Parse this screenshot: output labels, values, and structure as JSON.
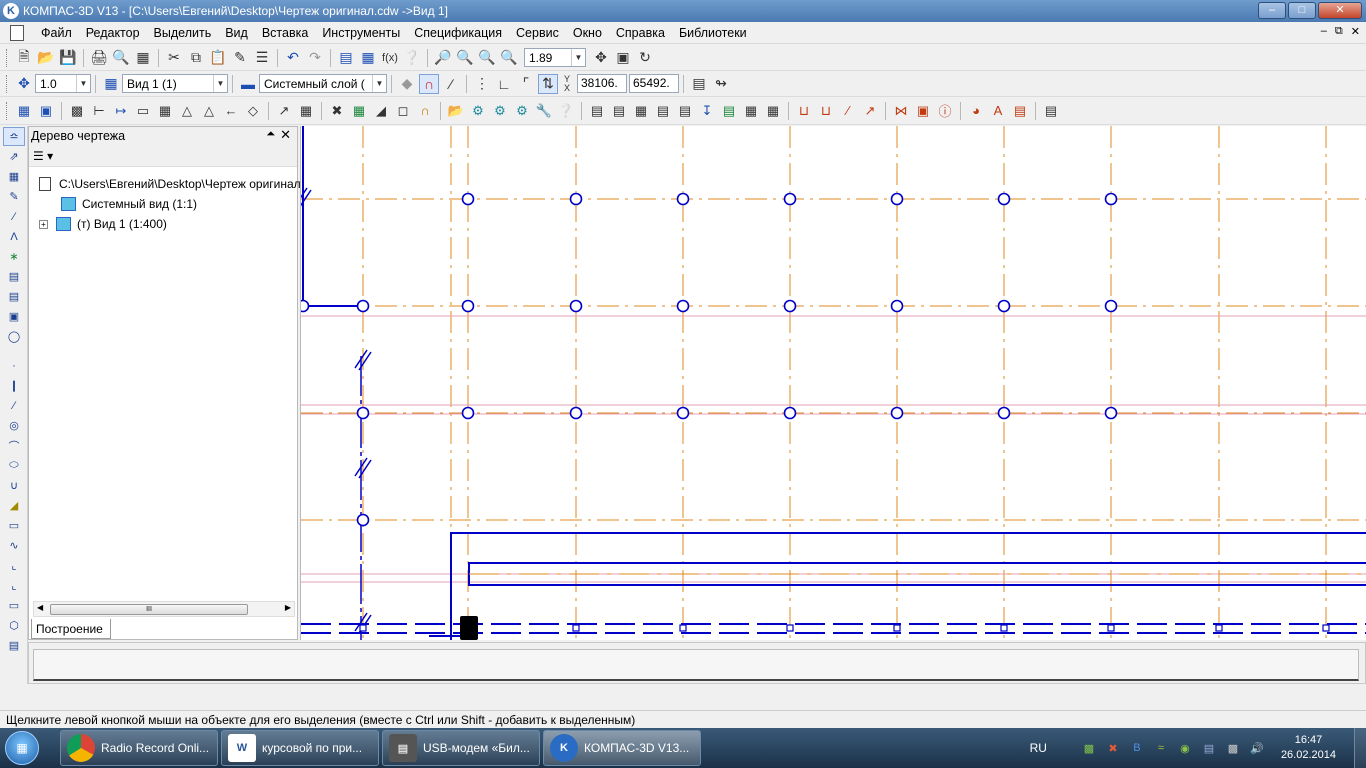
{
  "window": {
    "title": "КОМПАС-3D V13 - [C:\\Users\\Евгений\\Desktop\\Чертеж оригинал.cdw ->Вид 1]",
    "app_icon_letter": "K"
  },
  "menu": [
    "Файл",
    "Редактор",
    "Выделить",
    "Вид",
    "Вставка",
    "Инструменты",
    "Спецификация",
    "Сервис",
    "Окно",
    "Справка",
    "Библиотеки"
  ],
  "toolbar_std": {
    "zoom_value": "1.89"
  },
  "toolbar_current": {
    "step_value": "1.0",
    "view_value": "Вид 1 (1)",
    "layer_value": "Системный слой (",
    "coord_x_label": "X",
    "coord_y_label": "Y",
    "coord_x": "38106.",
    "coord_y": "65492."
  },
  "tree": {
    "title": "Дерево чертежа",
    "root": "C:\\Users\\Евгений\\Desktop\\Чертеж оригинал.cdw",
    "items": [
      {
        "label": "Системный вид (1:1)"
      },
      {
        "label": "(т) Вид 1 (1:400)"
      }
    ],
    "tab": "Построение",
    "scroll_grip": "III"
  },
  "status": {
    "text": "Щелкните левой кнопкой мыши на объекте для его выделения (вместе с Ctrl или Shift - добавить к выделенным)"
  },
  "taskbar": {
    "items": [
      {
        "label": "Radio Record Onli..."
      },
      {
        "label": "курсовой по при..."
      },
      {
        "label": "USB-модем «Бил..."
      },
      {
        "label": "КОМПАС-3D V13..."
      }
    ],
    "lang": "RU",
    "time": "16:47",
    "date": "26.02.2014"
  },
  "colors": {
    "axis": "#e08a1e",
    "geometry": "#0000c8",
    "thin": "#e6a0b4",
    "canvas": "#ffffff"
  }
}
